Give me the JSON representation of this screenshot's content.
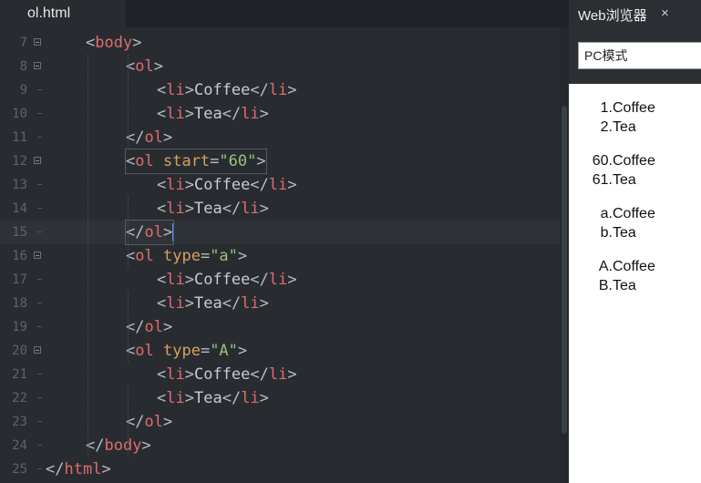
{
  "editor": {
    "tab_title": "ol.html",
    "lines": [
      {
        "num": "7",
        "indent": 1,
        "fold": true,
        "segs": [
          [
            "bracket",
            "<"
          ],
          [
            "tag",
            "body"
          ],
          [
            "bracket",
            ">"
          ]
        ]
      },
      {
        "num": "8",
        "indent": 2,
        "fold": true,
        "segs": [
          [
            "bracket",
            "<"
          ],
          [
            "tag",
            "ol"
          ],
          [
            "bracket",
            ">"
          ]
        ]
      },
      {
        "num": "9",
        "indent": 3,
        "fold": false,
        "segs": [
          [
            "bracket",
            "<"
          ],
          [
            "tag",
            "li"
          ],
          [
            "bracket",
            ">"
          ],
          [
            "plain",
            "Coffee"
          ],
          [
            "bracket",
            "</"
          ],
          [
            "tag",
            "li"
          ],
          [
            "bracket",
            ">"
          ]
        ]
      },
      {
        "num": "10",
        "indent": 3,
        "fold": false,
        "segs": [
          [
            "bracket",
            "<"
          ],
          [
            "tag",
            "li"
          ],
          [
            "bracket",
            ">"
          ],
          [
            "plain",
            "Tea"
          ],
          [
            "bracket",
            "</"
          ],
          [
            "tag",
            "li"
          ],
          [
            "bracket",
            ">"
          ]
        ]
      },
      {
        "num": "11",
        "indent": 2,
        "fold": false,
        "segs": [
          [
            "bracket",
            "</"
          ],
          [
            "tag",
            "ol"
          ],
          [
            "bracket",
            ">"
          ]
        ]
      },
      {
        "num": "12",
        "indent": 2,
        "fold": true,
        "boxed": true,
        "segs": [
          [
            "bracket",
            "<"
          ],
          [
            "tag",
            "ol"
          ],
          [
            "plain",
            " "
          ],
          [
            "attr",
            "start"
          ],
          [
            "eq",
            "="
          ],
          [
            "str",
            "\"60\""
          ],
          [
            "bracket",
            ">"
          ]
        ]
      },
      {
        "num": "13",
        "indent": 3,
        "fold": false,
        "segs": [
          [
            "bracket",
            "<"
          ],
          [
            "tag",
            "li"
          ],
          [
            "bracket",
            ">"
          ],
          [
            "plain",
            "Coffee"
          ],
          [
            "bracket",
            "</"
          ],
          [
            "tag",
            "li"
          ],
          [
            "bracket",
            ">"
          ]
        ]
      },
      {
        "num": "14",
        "indent": 3,
        "fold": false,
        "segs": [
          [
            "bracket",
            "<"
          ],
          [
            "tag",
            "li"
          ],
          [
            "bracket",
            ">"
          ],
          [
            "plain",
            "Tea"
          ],
          [
            "bracket",
            "</"
          ],
          [
            "tag",
            "li"
          ],
          [
            "bracket",
            ">"
          ]
        ]
      },
      {
        "num": "15",
        "indent": 2,
        "fold": false,
        "active": true,
        "boxed": true,
        "cursor": true,
        "segs": [
          [
            "bracket",
            "</"
          ],
          [
            "tag",
            "ol"
          ],
          [
            "bracket",
            ">"
          ]
        ]
      },
      {
        "num": "16",
        "indent": 2,
        "fold": true,
        "segs": [
          [
            "bracket",
            "<"
          ],
          [
            "tag",
            "ol"
          ],
          [
            "plain",
            " "
          ],
          [
            "attr",
            "type"
          ],
          [
            "eq",
            "="
          ],
          [
            "str",
            "\"a\""
          ],
          [
            "bracket",
            ">"
          ]
        ]
      },
      {
        "num": "17",
        "indent": 3,
        "fold": false,
        "segs": [
          [
            "bracket",
            "<"
          ],
          [
            "tag",
            "li"
          ],
          [
            "bracket",
            ">"
          ],
          [
            "plain",
            "Coffee"
          ],
          [
            "bracket",
            "</"
          ],
          [
            "tag",
            "li"
          ],
          [
            "bracket",
            ">"
          ]
        ]
      },
      {
        "num": "18",
        "indent": 3,
        "fold": false,
        "segs": [
          [
            "bracket",
            "<"
          ],
          [
            "tag",
            "li"
          ],
          [
            "bracket",
            ">"
          ],
          [
            "plain",
            "Tea"
          ],
          [
            "bracket",
            "</"
          ],
          [
            "tag",
            "li"
          ],
          [
            "bracket",
            ">"
          ]
        ]
      },
      {
        "num": "19",
        "indent": 2,
        "fold": false,
        "segs": [
          [
            "bracket",
            "</"
          ],
          [
            "tag",
            "ol"
          ],
          [
            "bracket",
            ">"
          ]
        ]
      },
      {
        "num": "20",
        "indent": 2,
        "fold": true,
        "segs": [
          [
            "bracket",
            "<"
          ],
          [
            "tag",
            "ol"
          ],
          [
            "plain",
            " "
          ],
          [
            "attr",
            "type"
          ],
          [
            "eq",
            "="
          ],
          [
            "str",
            "\"A\""
          ],
          [
            "bracket",
            ">"
          ]
        ]
      },
      {
        "num": "21",
        "indent": 3,
        "fold": false,
        "segs": [
          [
            "bracket",
            "<"
          ],
          [
            "tag",
            "li"
          ],
          [
            "bracket",
            ">"
          ],
          [
            "plain",
            "Coffee"
          ],
          [
            "bracket",
            "</"
          ],
          [
            "tag",
            "li"
          ],
          [
            "bracket",
            ">"
          ]
        ]
      },
      {
        "num": "22",
        "indent": 3,
        "fold": false,
        "segs": [
          [
            "bracket",
            "<"
          ],
          [
            "tag",
            "li"
          ],
          [
            "bracket",
            ">"
          ],
          [
            "plain",
            "Tea"
          ],
          [
            "bracket",
            "</"
          ],
          [
            "tag",
            "li"
          ],
          [
            "bracket",
            ">"
          ]
        ]
      },
      {
        "num": "23",
        "indent": 2,
        "fold": false,
        "segs": [
          [
            "bracket",
            "</"
          ],
          [
            "tag",
            "ol"
          ],
          [
            "bracket",
            ">"
          ]
        ]
      },
      {
        "num": "24",
        "indent": 1,
        "fold": false,
        "segs": [
          [
            "bracket",
            "</"
          ],
          [
            "tag",
            "body"
          ],
          [
            "bracket",
            ">"
          ]
        ]
      },
      {
        "num": "25",
        "indent": 0,
        "fold": false,
        "segs": [
          [
            "bracket",
            "</"
          ],
          [
            "tag",
            "html"
          ],
          [
            "bracket",
            ">"
          ]
        ]
      }
    ]
  },
  "browser": {
    "tab_title": "Web浏览器",
    "close_glyph": "×",
    "mode_select": "PC模式",
    "lists": [
      {
        "items": [
          {
            "marker": "1.",
            "text": "Coffee"
          },
          {
            "marker": "2.",
            "text": "Tea"
          }
        ]
      },
      {
        "items": [
          {
            "marker": "60.",
            "text": "Coffee"
          },
          {
            "marker": "61.",
            "text": "Tea"
          }
        ]
      },
      {
        "items": [
          {
            "marker": "a.",
            "text": "Coffee"
          },
          {
            "marker": "b.",
            "text": "Tea"
          }
        ]
      },
      {
        "items": [
          {
            "marker": "A.",
            "text": "Coffee"
          },
          {
            "marker": "B.",
            "text": "Tea"
          }
        ]
      }
    ]
  },
  "colors": {
    "editor_bg": "#282c31",
    "tag": "#e06c6c",
    "attribute": "#d9a05b",
    "string": "#98c379",
    "cursor": "#528bff"
  }
}
